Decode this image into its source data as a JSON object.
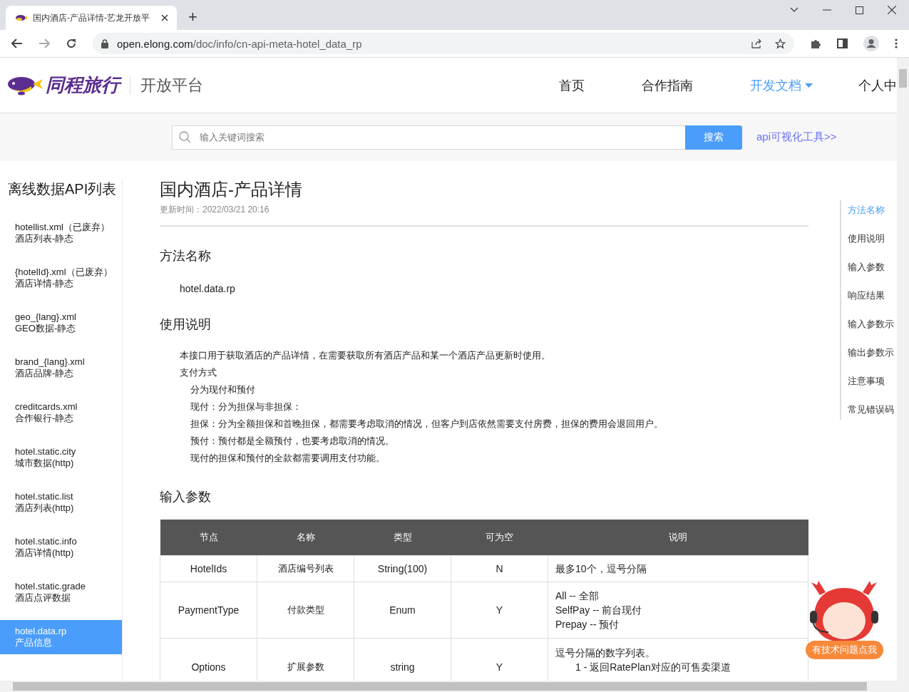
{
  "browser": {
    "tab_title": "国内酒店-产品详情-艺龙开放平",
    "new_tab": "+",
    "url_host": "open.elong.com",
    "url_path": "/doc/info/cn-api-meta-hotel_data_rp"
  },
  "header": {
    "brand": "同程旅行",
    "platform": "开放平台",
    "nav": [
      {
        "label": "首页",
        "selected": false,
        "menu": false
      },
      {
        "label": "合作指南",
        "selected": false,
        "menu": false
      },
      {
        "label": "开发文档",
        "selected": true,
        "menu": true
      },
      {
        "label": "个人中",
        "selected": false,
        "menu": false
      }
    ]
  },
  "search": {
    "placeholder": "输入关键词搜索",
    "button": "搜索",
    "tool_link": "api可视化工具>>"
  },
  "sidebar": {
    "title": "离线数据API列表",
    "items": [
      {
        "name": "hotellist.xml（已废弃）",
        "desc": "酒店列表-静态",
        "selected": false
      },
      {
        "name": "{hotelId}.xml（已废弃）",
        "desc": "酒店详情-静态",
        "selected": false
      },
      {
        "name": "geo_{lang}.xml",
        "desc": "GEO数据-静态",
        "selected": false
      },
      {
        "name": "brand_{lang}.xml",
        "desc": "酒店品牌-静态",
        "selected": false
      },
      {
        "name": "creditcards.xml",
        "desc": "合作银行-静态",
        "selected": false
      },
      {
        "name": "hotel.static.city",
        "desc": "城市数据(http)",
        "selected": false
      },
      {
        "name": "hotel.static.list",
        "desc": "酒店列表(http)",
        "selected": false
      },
      {
        "name": "hotel.static.info",
        "desc": "酒店详情(http)",
        "selected": false
      },
      {
        "name": "hotel.static.grade",
        "desc": "酒店点评数据",
        "selected": false
      },
      {
        "name": "hotel.data.rp",
        "desc": "产品信息",
        "selected": true
      }
    ]
  },
  "doc": {
    "title": "国内酒店-产品详情",
    "updated": "更新时间：2022/03/21 20:16",
    "method_heading": "方法名称",
    "method": "hotel.data.rp",
    "usage_heading": "使用说明",
    "usage": [
      {
        "text": "本接口用于获取酒店的产品详情，在需要获取所有酒店产品和某一个酒店产品更新时使用。"
      },
      {
        "text": "支付方式",
        "children": [
          {
            "text": "分为现付和预付"
          },
          {
            "text": "现付：分为担保与非担保："
          },
          {
            "text": "担保：分为全额担保和首晚担保，都需要考虑取消的情况，但客户到店依然需要支付房费，担保的费用会退回用户。"
          },
          {
            "text": "预付：预付都是全额预付，也要考虑取消的情况。"
          },
          {
            "text": "现付的担保和预付的全款都需要调用支付功能。"
          }
        ]
      }
    ],
    "input_heading": "输入参数",
    "table": {
      "columns": [
        "节点",
        "名称",
        "类型",
        "可为空",
        "说明"
      ],
      "rows": [
        {
          "node": "HotelIds",
          "name": "酒店编号列表",
          "type": "String(100)",
          "nullable": "N",
          "lines": [
            "最多10个，逗号分隔"
          ]
        },
        {
          "node": "PaymentType",
          "name": "付款类型",
          "type": "Enum",
          "nullable": "Y",
          "lines": [
            "All -- 全部",
            "SelfPay -- 前台现付",
            "Prepay -- 预付"
          ]
        },
        {
          "node": "Options",
          "name": "扩展参数",
          "type": "string",
          "nullable": "Y",
          "lines": [
            "逗号分隔的数字列表。"
          ],
          "sub_lines": [
            "1 - 返回RatePlan对应的可售卖渠道"
          ]
        }
      ]
    }
  },
  "toc": [
    {
      "label": "方法名称",
      "selected": true
    },
    {
      "label": "使用说明",
      "selected": false
    },
    {
      "label": "输入参数",
      "selected": false
    },
    {
      "label": "响应结果",
      "selected": false
    },
    {
      "label": "输入参数示",
      "selected": false
    },
    {
      "label": "输出参数示",
      "selected": false
    },
    {
      "label": "注意事项",
      "selected": false
    },
    {
      "label": "常见错误码",
      "selected": false
    }
  ],
  "help_badge": "有技术问题点我"
}
